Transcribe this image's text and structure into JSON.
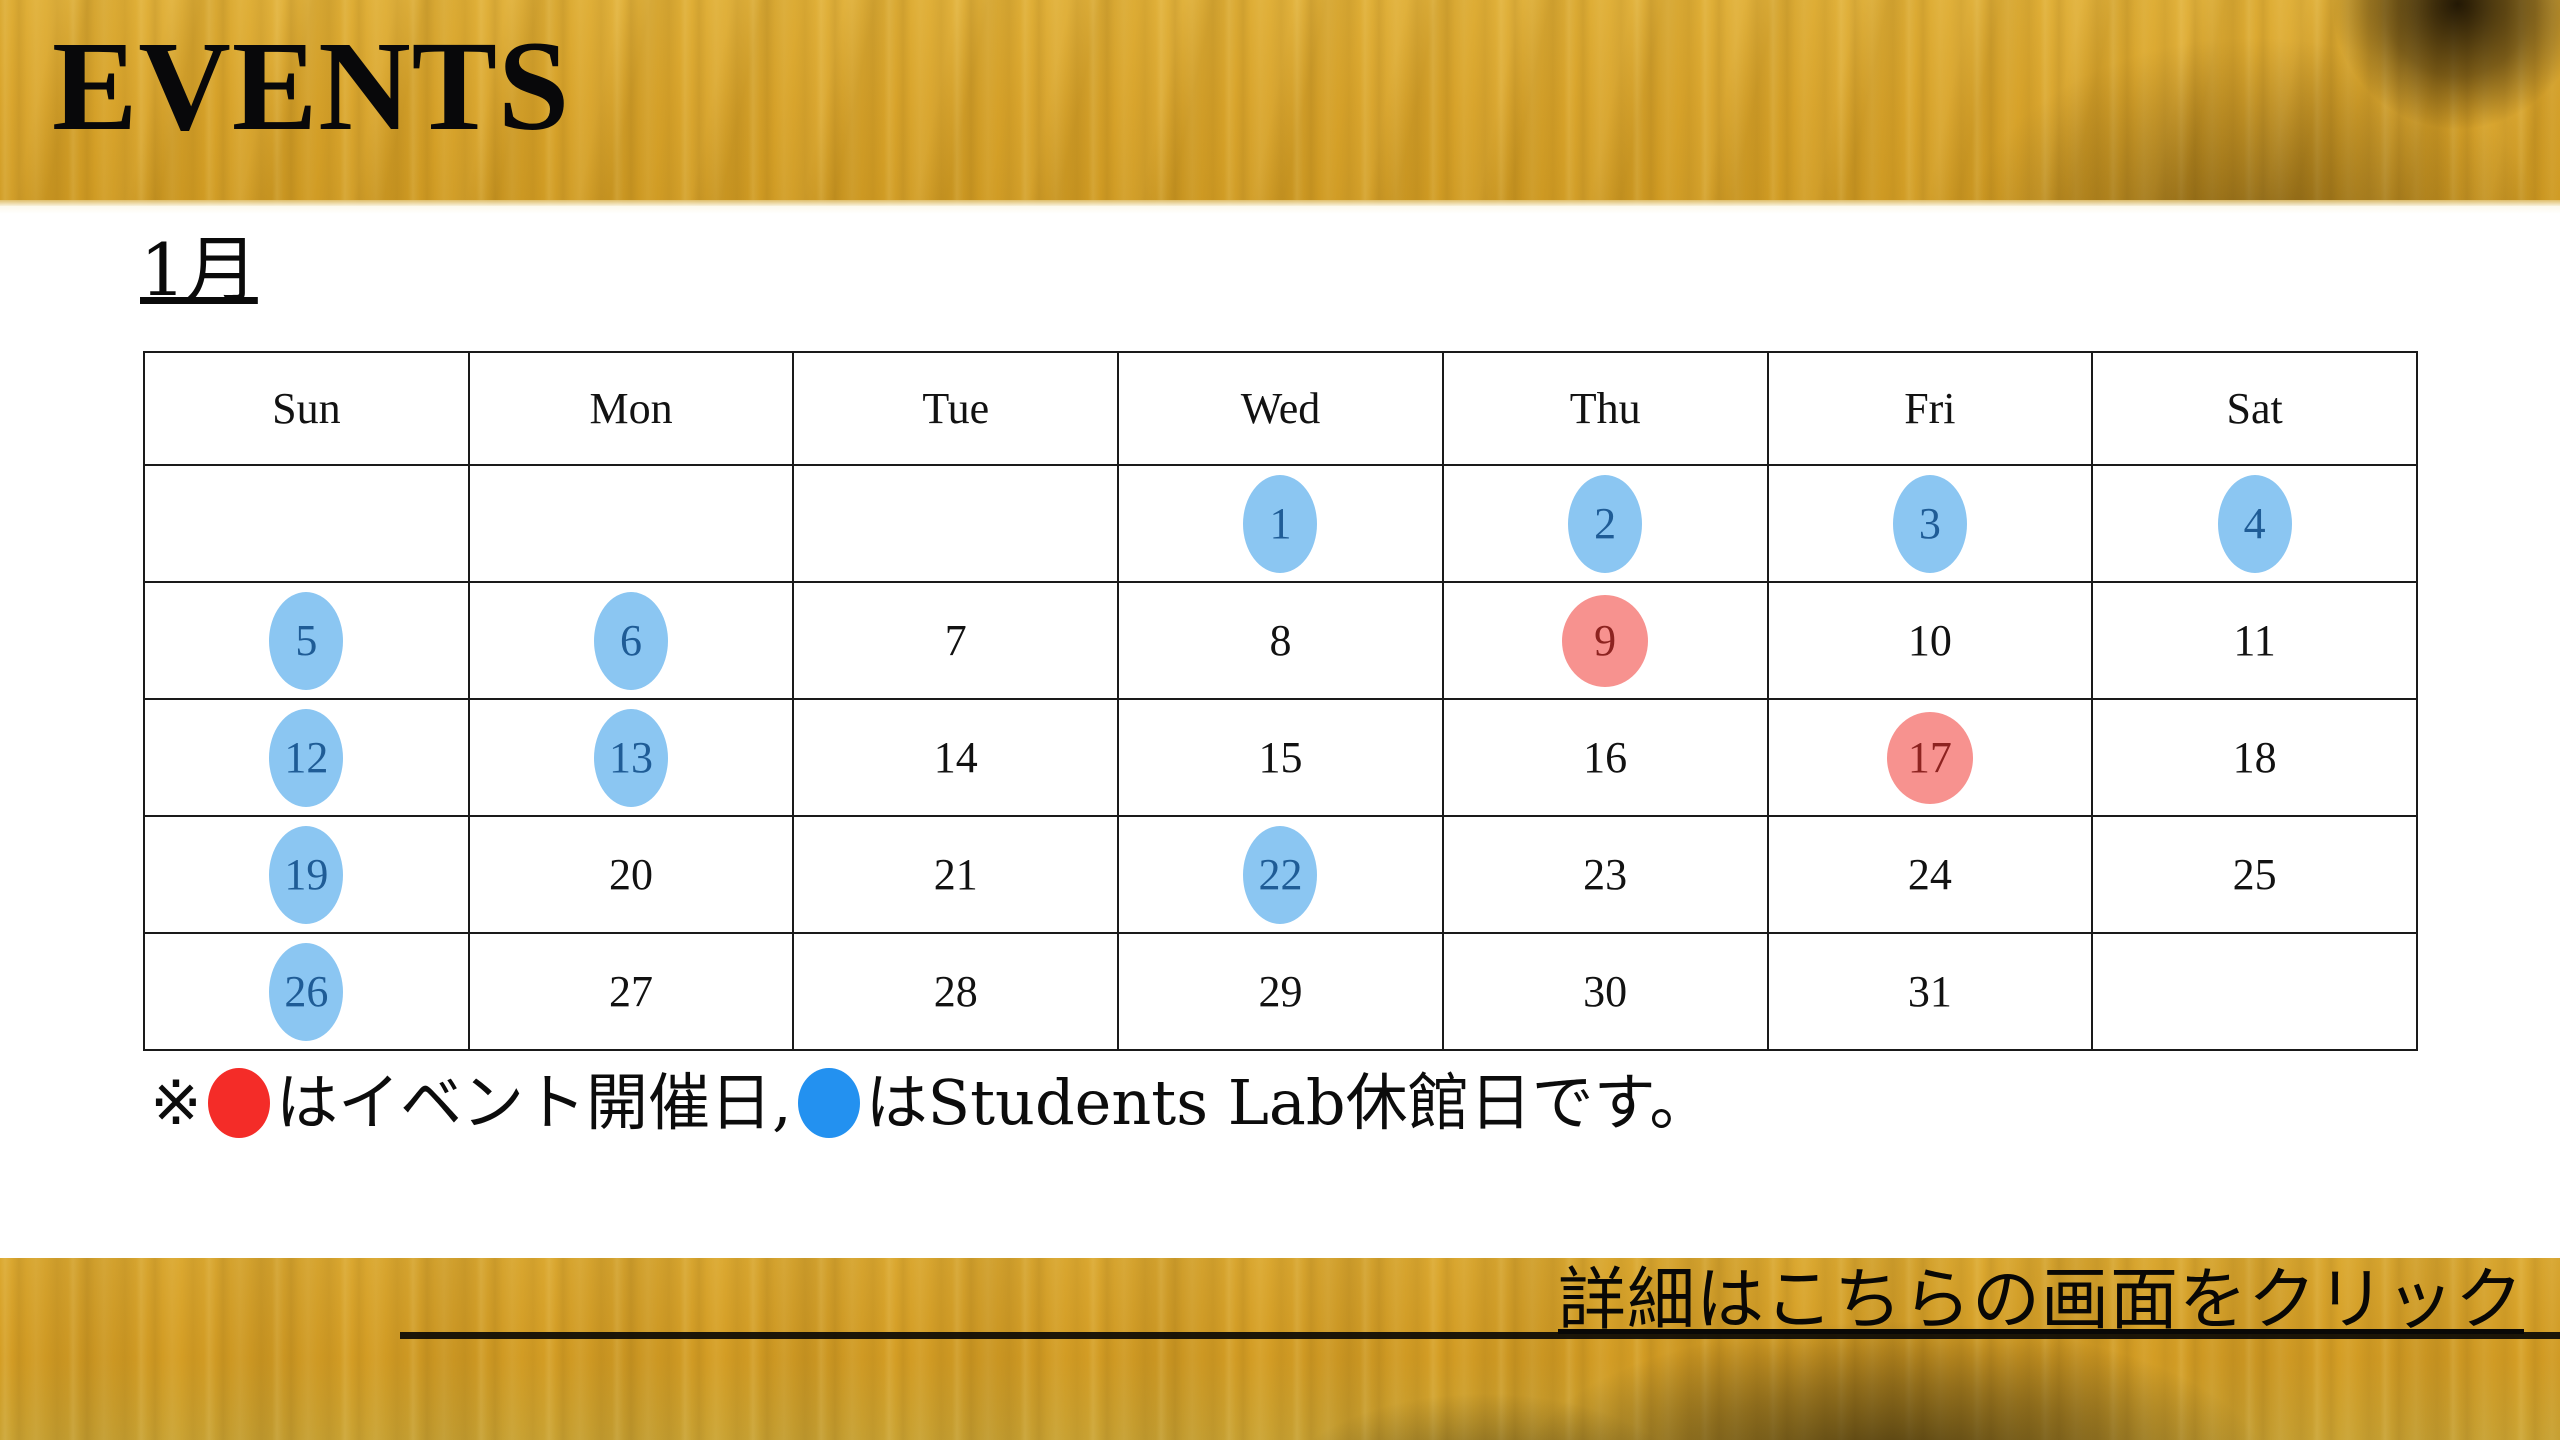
{
  "slide": {
    "title": "EVENTS",
    "month_label": "1月"
  },
  "theme": {
    "banner_color": "#d6a028",
    "blue_circle_fill": "#8bc6f2",
    "blue_circle_text": "#1f5c96",
    "red_circle_fill": "#f7928f",
    "red_circle_text": "#8d2320",
    "legend_red_dot": "#f42c28",
    "legend_blue_dot": "#2391f0",
    "table_border": "#1a1a1a",
    "text_color": "#121212"
  },
  "calendar": {
    "weekday_headers": [
      "Sun",
      "Mon",
      "Tue",
      "Wed",
      "Thu",
      "Fri",
      "Sat"
    ],
    "weeks": [
      [
        {
          "day": "",
          "mark": "none"
        },
        {
          "day": "",
          "mark": "none"
        },
        {
          "day": "",
          "mark": "none"
        },
        {
          "day": "1",
          "mark": "blue"
        },
        {
          "day": "2",
          "mark": "blue"
        },
        {
          "day": "3",
          "mark": "blue"
        },
        {
          "day": "4",
          "mark": "blue"
        }
      ],
      [
        {
          "day": "5",
          "mark": "blue"
        },
        {
          "day": "6",
          "mark": "blue"
        },
        {
          "day": "7",
          "mark": "plain"
        },
        {
          "day": "8",
          "mark": "plain"
        },
        {
          "day": "9",
          "mark": "red"
        },
        {
          "day": "10",
          "mark": "plain"
        },
        {
          "day": "11",
          "mark": "plain"
        }
      ],
      [
        {
          "day": "12",
          "mark": "blue"
        },
        {
          "day": "13",
          "mark": "blue"
        },
        {
          "day": "14",
          "mark": "plain"
        },
        {
          "day": "15",
          "mark": "plain"
        },
        {
          "day": "16",
          "mark": "plain"
        },
        {
          "day": "17",
          "mark": "red"
        },
        {
          "day": "18",
          "mark": "plain"
        }
      ],
      [
        {
          "day": "19",
          "mark": "blue"
        },
        {
          "day": "20",
          "mark": "plain"
        },
        {
          "day": "21",
          "mark": "plain"
        },
        {
          "day": "22",
          "mark": "blue"
        },
        {
          "day": "23",
          "mark": "plain"
        },
        {
          "day": "24",
          "mark": "plain"
        },
        {
          "day": "25",
          "mark": "plain"
        }
      ],
      [
        {
          "day": "26",
          "mark": "blue"
        },
        {
          "day": "27",
          "mark": "plain"
        },
        {
          "day": "28",
          "mark": "plain"
        },
        {
          "day": "29",
          "mark": "plain"
        },
        {
          "day": "30",
          "mark": "plain"
        },
        {
          "day": "31",
          "mark": "plain"
        },
        {
          "day": "",
          "mark": "none"
        }
      ]
    ]
  },
  "legend": {
    "prefix": "※",
    "red_text": "はイベント開催日,",
    "blue_text": "はStudents Lab休館日です。",
    "red_dot_icon": "red-circle-icon",
    "blue_dot_icon": "blue-circle-icon"
  },
  "footer": {
    "link_text": "詳細はこちらの画面をクリック"
  }
}
